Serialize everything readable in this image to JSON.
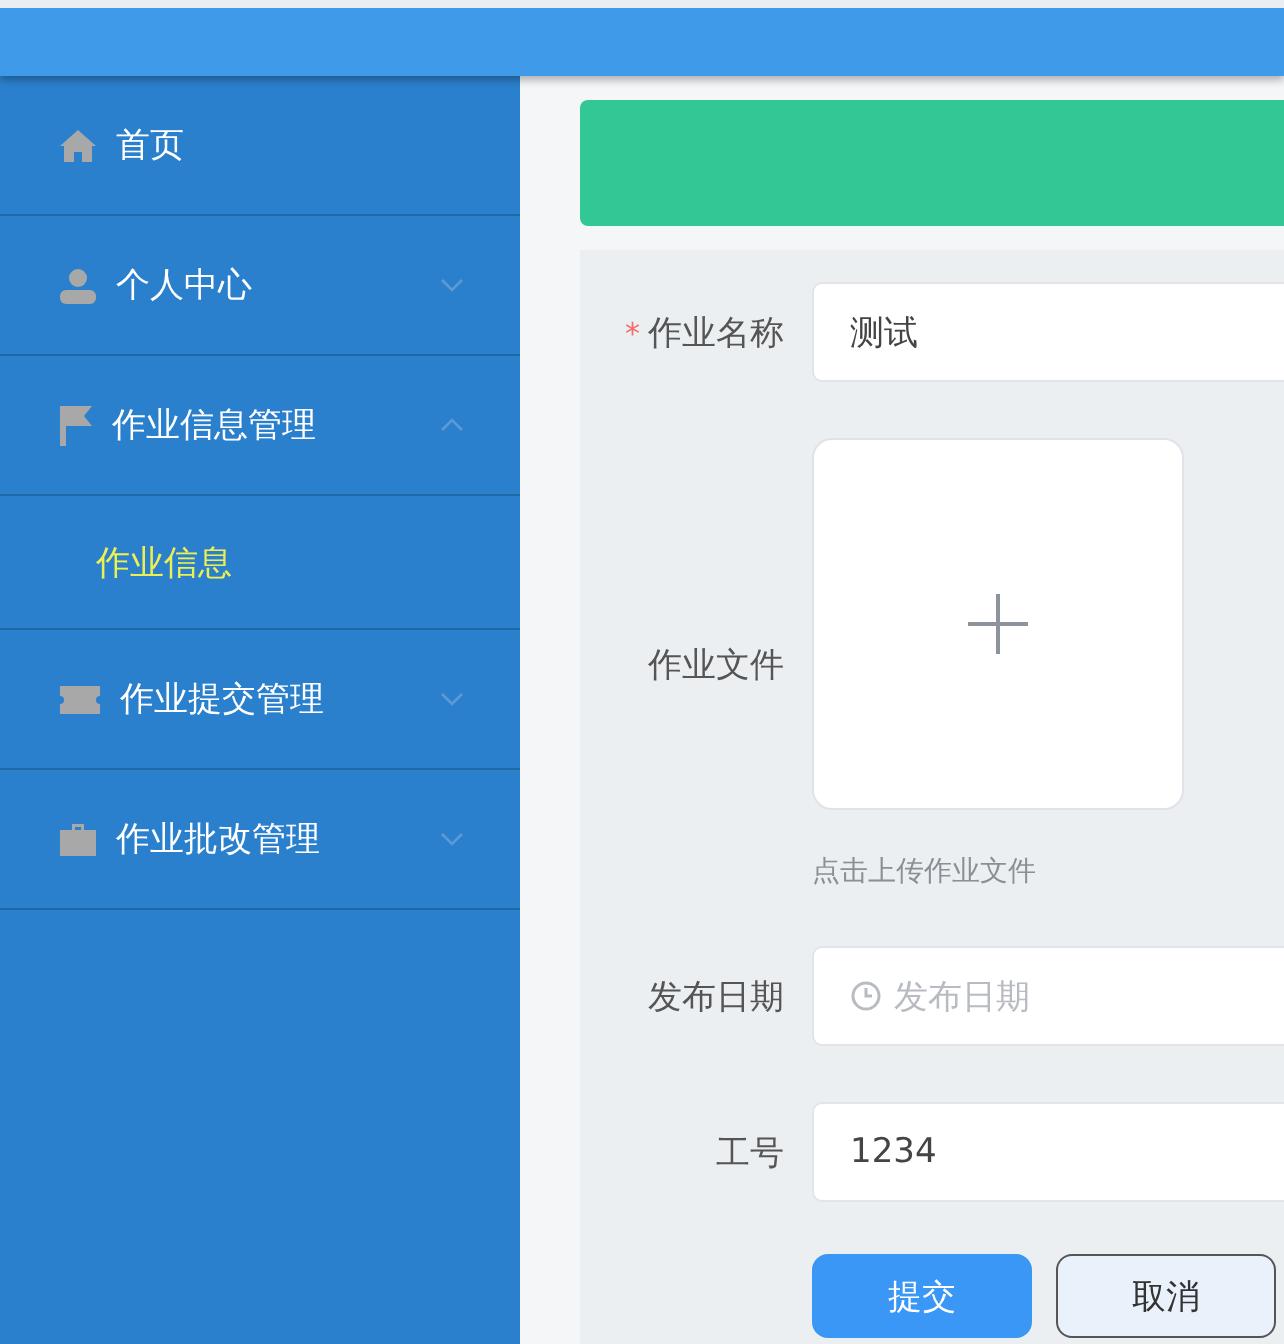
{
  "sidebar": {
    "items": [
      {
        "label": "首页",
        "has_children": false
      },
      {
        "label": "个人中心",
        "expanded": false,
        "has_children": true
      },
      {
        "label": "作业信息管理",
        "expanded": true,
        "has_children": true,
        "children": [
          {
            "label": "作业信息",
            "selected": true
          }
        ]
      },
      {
        "label": "作业提交管理",
        "expanded": false,
        "has_children": true
      },
      {
        "label": "作业批改管理",
        "expanded": false,
        "has_children": true
      }
    ]
  },
  "form": {
    "fields": [
      {
        "kind": "text",
        "required_mark": "*",
        "label": "作业名称",
        "value": "测试"
      },
      {
        "kind": "upload",
        "label": "作业文件",
        "hint": "点击上传作业文件"
      },
      {
        "kind": "date",
        "label": "发布日期",
        "placeholder": "发布日期"
      },
      {
        "kind": "text",
        "label": "工号",
        "value": "1234"
      }
    ],
    "buttons": [
      {
        "kind": "primary",
        "label": "提交"
      },
      {
        "kind": "default",
        "label": "取消"
      }
    ]
  }
}
